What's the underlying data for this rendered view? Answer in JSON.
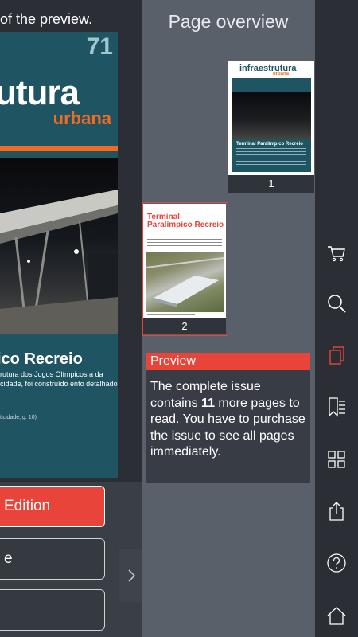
{
  "left": {
    "top_text": "of the preview.",
    "cover": {
      "issue": "71",
      "brand": "utura",
      "sub": "urbana",
      "title": "ico Recreio",
      "desc": "rutura dos Jogos Olímpicos a da cidade, foi construído ento detalhado",
      "small": "ticidade, g. 10)"
    },
    "buttons": {
      "edition": "Edition",
      "second": "e",
      "third": ""
    }
  },
  "overview": {
    "title": "Page overview",
    "pages": [
      {
        "label": "1",
        "brand": "infraestrutura",
        "sub": "urbana",
        "issue": "71",
        "cover_title": "Terminal Paralímpico Recreio"
      },
      {
        "label": "2",
        "title_line1": "Terminal",
        "title_line2": "Paralímpico Recreio",
        "small": "OBRA"
      }
    ],
    "preview": {
      "heading": "Preview",
      "text_before": "The complete issue contains ",
      "count": "11",
      "text_after": " more pages to read. You have to purchase the issue to see all pages immediately."
    }
  },
  "toolbar": {
    "items": [
      "cart-icon",
      "search-icon",
      "pages-icon",
      "bookmarks-icon",
      "grid-icon",
      "share-icon",
      "help-icon",
      "home-icon"
    ],
    "active_color": "#e8443a"
  },
  "colors": {
    "accent": "#e8443a",
    "brand_orange": "#f26b21",
    "cover_teal": "#1f5563"
  }
}
